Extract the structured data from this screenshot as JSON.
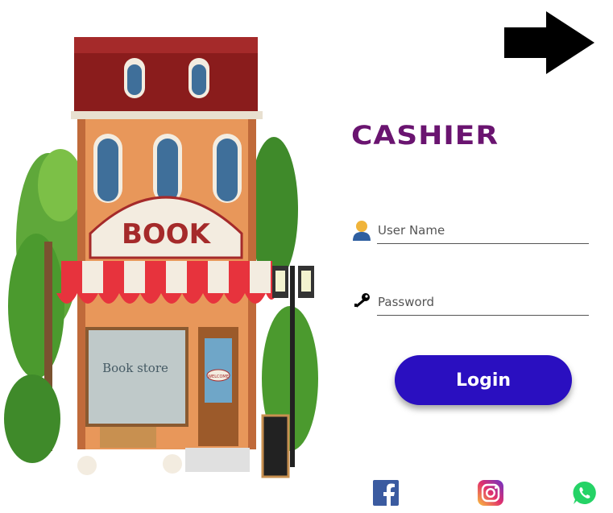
{
  "brand": {
    "title": "CASHIER",
    "title_color": "#6a1470"
  },
  "storefront": {
    "sign": "BOOK",
    "window_text": "Book store",
    "door_sign": "WELCOME"
  },
  "form": {
    "username_placeholder": "User Name",
    "password_placeholder": "Password",
    "login_label": "Login",
    "accent": "#2a0fc0"
  },
  "icons": {
    "next": "right-arrow-icon",
    "user": "user-icon",
    "key": "key-icon",
    "social": [
      "facebook-icon",
      "instagram-icon",
      "whatsapp-icon"
    ]
  }
}
